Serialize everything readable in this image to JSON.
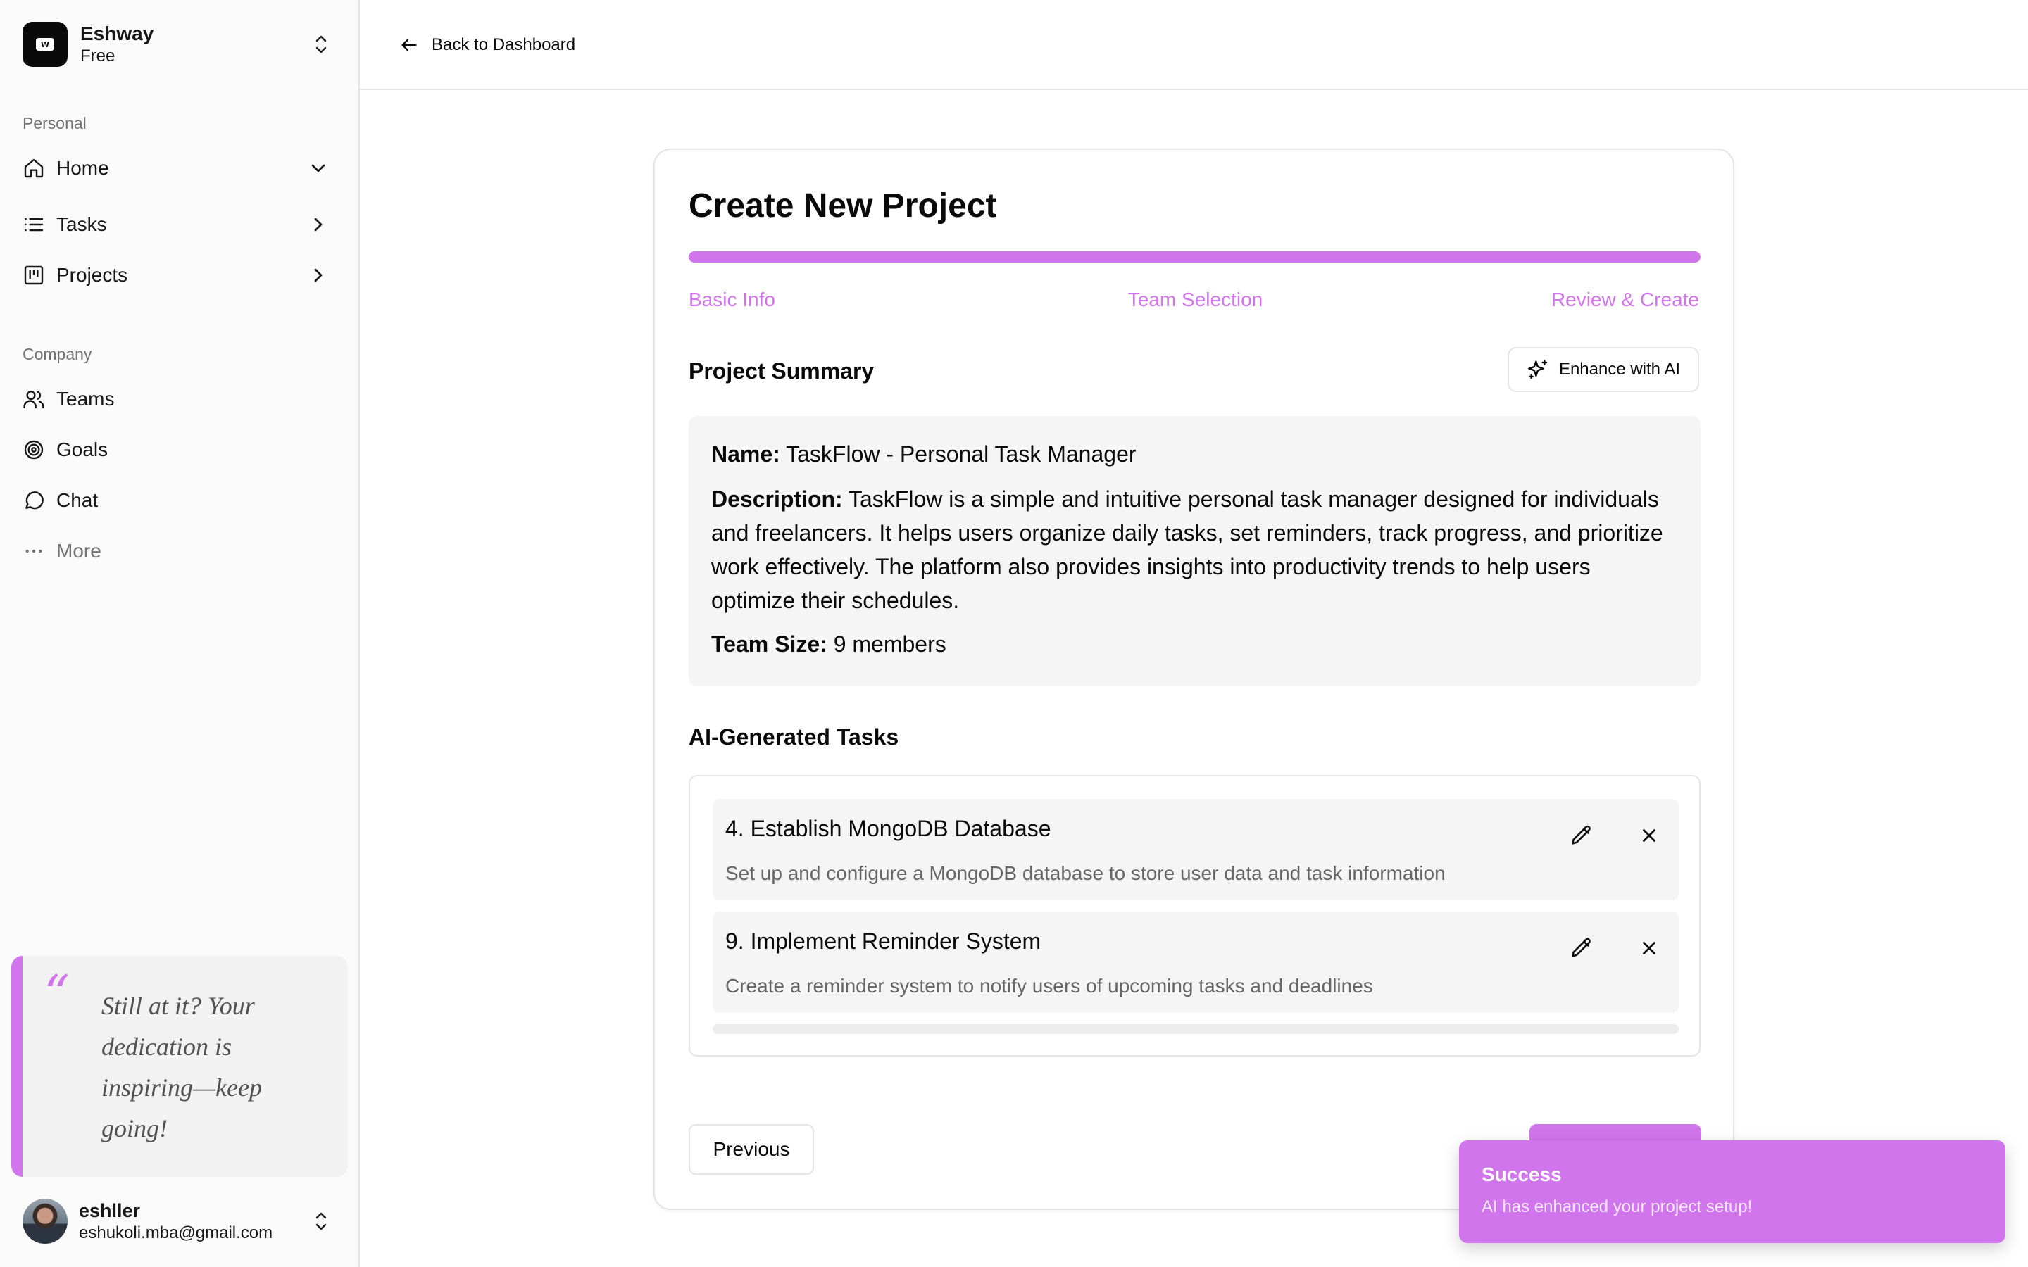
{
  "workspace": {
    "name": "Eshway",
    "plan": "Free",
    "logo_text": "W"
  },
  "sidebar": {
    "personal_label": "Personal",
    "personal_items": [
      {
        "label": "Home",
        "icon": "home-icon",
        "chevron": "chevron-down-icon"
      },
      {
        "label": "Tasks",
        "icon": "list-icon",
        "chevron": "chevron-right-icon"
      },
      {
        "label": "Projects",
        "icon": "kanban-icon",
        "chevron": "chevron-right-icon"
      }
    ],
    "company_label": "Company",
    "company_items": [
      {
        "label": "Teams",
        "icon": "users-icon"
      },
      {
        "label": "Goals",
        "icon": "target-icon"
      },
      {
        "label": "Chat",
        "icon": "message-circle-icon"
      },
      {
        "label": "More",
        "icon": "ellipsis-icon"
      }
    ],
    "quote": "Still at it? Your dedication is inspiring—keep going!",
    "user": {
      "name": "eshller",
      "email": "eshukoli.mba@gmail.com"
    }
  },
  "topbar": {
    "back_label": "Back to Dashboard"
  },
  "wizard": {
    "title": "Create New Project",
    "progress_percent": 100,
    "steps": [
      "Basic Info",
      "Team Selection",
      "Review & Create"
    ],
    "summary_heading": "Project Summary",
    "enhance_label": "Enhance with AI",
    "summary": {
      "name_label": "Name:",
      "name_value": "TaskFlow - Personal Task Manager",
      "description_label": "Description:",
      "description_value": "TaskFlow is a simple and intuitive personal task manager designed for individuals and freelancers. It helps users organize daily tasks, set reminders, track progress, and prioritize work effectively. The platform also provides insights into productivity trends to help users optimize their schedules.",
      "team_size_label": "Team Size:",
      "team_size_value": "9 members"
    },
    "tasks_heading": "AI-Generated Tasks",
    "tasks": [
      {
        "title": "4. Establish MongoDB Database",
        "description": "Set up and configure a MongoDB database to store user data and task information"
      },
      {
        "title": "9. Implement Reminder System",
        "description": "Create a reminder system to notify users of upcoming tasks and deadlines"
      }
    ],
    "previous_label": "Previous"
  },
  "toast": {
    "title": "Success",
    "message": "AI has enhanced your project setup!"
  },
  "colors": {
    "accent": "#d175ec",
    "sidebar_bg": "#fafafa",
    "panel_bg": "#f5f5f5",
    "border": "#e5e5e5"
  }
}
